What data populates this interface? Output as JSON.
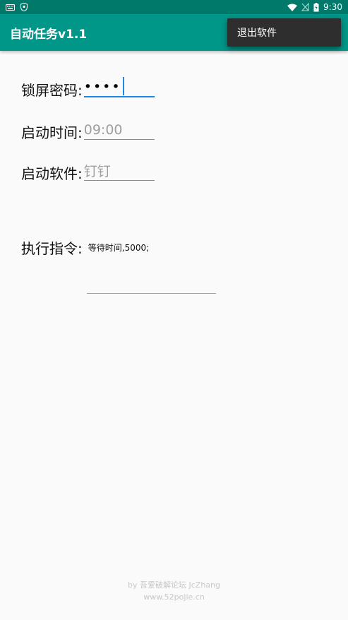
{
  "status_bar": {
    "time": "9:30",
    "icons": [
      "keyboard-icon",
      "shield-icon",
      "wifi-icon",
      "no-sim-icon",
      "battery-icon"
    ]
  },
  "app_bar": {
    "title": "自动任务v1.1",
    "background": "#009688"
  },
  "menu": {
    "items": [
      {
        "label": "退出软件"
      }
    ]
  },
  "form": {
    "lock_password": {
      "label": "锁屏密码:",
      "value": "••••"
    },
    "start_time": {
      "label": "启动时间:",
      "placeholder": "09:00"
    },
    "start_app": {
      "label": "启动软件:",
      "placeholder": "钉钉"
    },
    "command": {
      "label": "执行指令:",
      "value": "等待时间,5000;"
    }
  },
  "footer": {
    "line1": "by 吾爱破解论坛 JcZhang",
    "line2": "www.52pojie.cn"
  },
  "colors": {
    "accent": "#1e88e5",
    "status_bar": "#00796b"
  }
}
